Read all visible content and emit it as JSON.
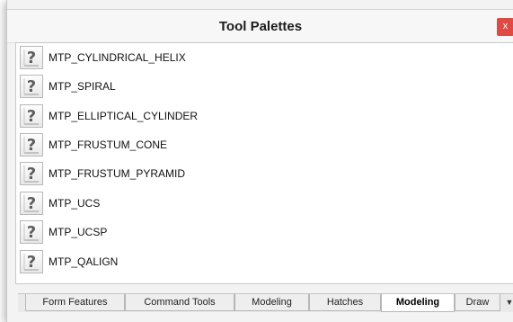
{
  "window": {
    "title": "Tool Palettes",
    "close_label": "x"
  },
  "tools": [
    {
      "label": "MTP_CYLINDRICAL_HELIX",
      "icon": "question-mark-icon"
    },
    {
      "label": "MTP_SPIRAL",
      "icon": "question-mark-icon"
    },
    {
      "label": "MTP_ELLIPTICAL_CYLINDER",
      "icon": "question-mark-icon"
    },
    {
      "label": "MTP_FRUSTUM_CONE",
      "icon": "question-mark-icon"
    },
    {
      "label": "MTP_FRUSTUM_PYRAMID",
      "icon": "question-mark-icon"
    },
    {
      "label": "MTP_UCS",
      "icon": "question-mark-icon"
    },
    {
      "label": "MTP_UCSP",
      "icon": "question-mark-icon"
    },
    {
      "label": "MTP_QALIGN",
      "icon": "question-mark-icon"
    }
  ],
  "tabs": [
    {
      "label": "Form Features",
      "active": false
    },
    {
      "label": "Command Tools",
      "active": false
    },
    {
      "label": "Modeling",
      "active": false
    },
    {
      "label": "Hatches",
      "active": false
    },
    {
      "label": "Modeling",
      "active": true
    },
    {
      "label": "Draw",
      "active": false
    }
  ],
  "tab_overflow_icon": "tab-overflow-icon",
  "colors": {
    "close_button": "#e04a44",
    "active_tab": "#ffffff",
    "tab": "#eeeeee"
  }
}
